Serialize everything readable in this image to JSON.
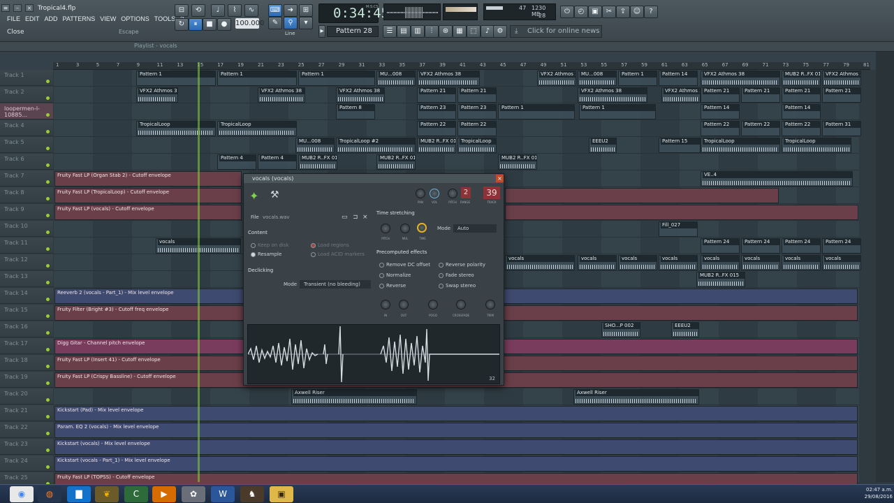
{
  "window": {
    "title": "Tropical4.flp"
  },
  "menu": [
    "FILE",
    "EDIT",
    "ADD",
    "PATTERNS",
    "VIEW",
    "OPTIONS",
    "TOOLS",
    "?"
  ],
  "hint": {
    "left": "Close",
    "right": "Escape"
  },
  "transport": {
    "tempo": "100.000",
    "time": "0:34:45",
    "time_label": "M:S:CS",
    "pattern": "Pattern 28",
    "snap": "Line"
  },
  "cpu": {
    "ram": "1230 MB",
    "cpu": "47",
    "polyphony": "28"
  },
  "news": "Click for online news",
  "playlist": {
    "title": "Playlist - vocals"
  },
  "ruler": [
    "1",
    "3",
    "5",
    "7",
    "9",
    "11",
    "13",
    "15",
    "17",
    "19",
    "21",
    "23",
    "25",
    "27",
    "29",
    "31",
    "33",
    "35",
    "37",
    "39",
    "41",
    "43",
    "45",
    "47",
    "49",
    "51",
    "53",
    "55",
    "57",
    "59",
    "61",
    "63",
    "65",
    "67",
    "69",
    "71",
    "73",
    "75",
    "77",
    "79",
    "81"
  ],
  "tracks": [
    "Track 1",
    "Track 2",
    "loopermen-l-10885...",
    "Track 4",
    "Track 5",
    "Track 6",
    "Track 7",
    "Track 8",
    "Track 9",
    "Track 10",
    "Track 11",
    "Track 12",
    "Track 13",
    "Track 14",
    "Track 15",
    "Track 16",
    "Track 17",
    "Track 18",
    "Track 19",
    "Track 20",
    "Track 21",
    "Track 22",
    "Track 23",
    "Track 24",
    "Track 25"
  ],
  "clips": {
    "pattern1": "Pattern 1",
    "vfx2": "VFX2 Athmos 38",
    "mu008": "MU...008",
    "pattern14": "Pattern 14",
    "pattern21": "Pattern 21",
    "pattern8": "Pattern 8",
    "pattern23": "Pattern 23",
    "tropicalloop": "TropicalLoop",
    "pattern22": "Pattern 22",
    "pattern31": "Pattern 31",
    "tropicalloop2": "TropicalLoop #2",
    "mub2": "MUB2 R..FX 015",
    "eeeu2": "EEEU2",
    "pattern15": "Pattern 15",
    "pattern4": "Pattern 4",
    "ve4": "VE..4",
    "fill027": "Fill_027",
    "pattern24": "Pattern 24",
    "vocals": "vocals",
    "sho": "SHO...P 002",
    "axwell": "Axwell Riser"
  },
  "automation": {
    "t7": "Fruity Fast LP (Organ Stab 2) - Cutoff envelope",
    "t8": "Fruity Fast LP (TropicalLoop) - Cutoff envelope",
    "t9": "Fruity Fast LP (vocals) - Cutoff envelope",
    "t14": "Reeverb 2 (vocals - Part_1) - Mix level envelope",
    "t15": "Fruity Filter (Bright #3) - Cutoff freq envelope",
    "t17": "Digg Gitar - Channel pitch envelope",
    "t18": "Fruity Fast LP (Insert 41) - Cutoff envelope",
    "t19": "Fruity Fast LP (Crispy Bassline) - Cutoff envelope",
    "t21": "Kickstart (Pad) - Mix level envelope",
    "t22": "Param. EQ 2 (vocals) - Mix level envelope",
    "t23": "Kickstart (vocals) - Mix level envelope",
    "t24": "Kickstart (vocals - Part_1) - Mix level envelope",
    "t25": "Fruity Fast LP (TOPSS) - Cutoff envelope"
  },
  "channel": {
    "title": "vocals (vocals)",
    "knob_labels": [
      "PAN",
      "VOL",
      "PITCH",
      "RANGE",
      "TRACK"
    ],
    "range": "2",
    "track": "39",
    "file_label": "File",
    "file_name": "vocals.wav",
    "content_label": "Content",
    "keep_on_disk": "Keep on disk",
    "resample": "Resample",
    "load_regions": "Load regions",
    "load_acid": "Load ACID markers",
    "declicking": "Declicking",
    "mode_label": "Mode",
    "declick_mode": "Transient (no bleeding)",
    "ts_title": "Time stretching",
    "ts_knobs": [
      "PITCH",
      "MUL",
      "TIME"
    ],
    "ts_mode_label": "Mode",
    "ts_mode": "Auto",
    "pre_title": "Precomputed effects",
    "effects_left": [
      "Remove DC offset",
      "Normalize",
      "Reverse"
    ],
    "effects_right": [
      "Reverse polarity",
      "Fade stereo",
      "Swap stereo"
    ],
    "fx_knobs": [
      "IN",
      "OUT",
      "POGO",
      "CROSSFADE",
      "TRIM"
    ],
    "wave_bits": "32"
  },
  "clock": {
    "time": "02:47 a.m.",
    "date": "29/08/2016"
  }
}
